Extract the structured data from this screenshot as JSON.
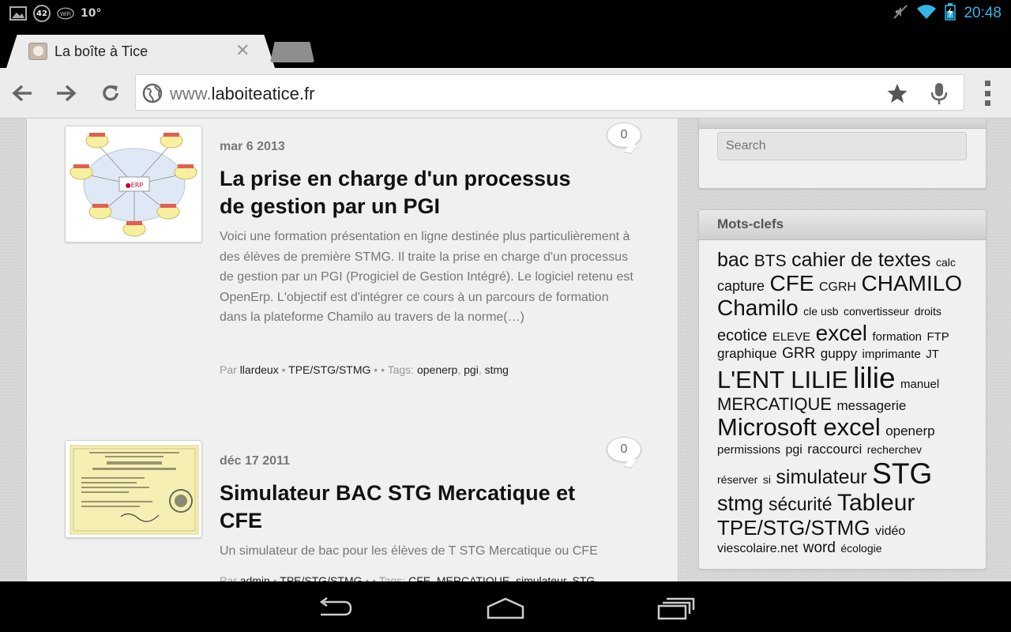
{
  "status_bar": {
    "battery_level": "42",
    "wifi_label": "WiFi",
    "temperature": "10°",
    "time": "20:48"
  },
  "browser": {
    "tab_title": "La boîte à Tice",
    "url_prefix": "www.",
    "url_domain": "laboiteatice.fr"
  },
  "posts": [
    {
      "date": "mar 6 2013",
      "title": "La prise en charge d'un processus de gestion par un PGI",
      "excerpt": "Voici une formation présentation en ligne destinée plus particulièrement à des élèves de première STMG. Il traite la prise en charge d'un processus de gestion par un PGI (Progiciel de Gestion Intégré). Le logiciel retenu est OpenErp. L'objectif est d'intégrer ce cours à un parcours de formation dans la plateforme Chamilo au travers de la norme(…)",
      "comments": "0",
      "meta_by": "Par",
      "author": "llardeux",
      "category": "TPE/STG/STMG",
      "tags_label": "• • Tags:",
      "tags": [
        "openerp",
        "pgi",
        "stmg"
      ]
    },
    {
      "date": "déc 17 2011",
      "title": "Simulateur BAC STG Mercatique et CFE",
      "excerpt": "Un simulateur de bac pour les élèves de T STG Mercatique ou CFE",
      "comments": "0",
      "meta_by": "Par",
      "author": "admin",
      "category": "TPE/STG/STMG",
      "tags_label": "• • Tags:",
      "tags": [
        "CFE",
        "MERCATIQUE",
        "simulateur",
        "STG"
      ]
    }
  ],
  "sidebar": {
    "search_placeholder": "Search",
    "tags_title": "Mots-clefs",
    "tag_cloud": [
      {
        "t": "bac",
        "s": 25
      },
      {
        "t": "BTS",
        "s": 21
      },
      {
        "t": "cahier de textes",
        "s": 25
      },
      {
        "t": "calc",
        "s": 14
      },
      {
        "t": "capture",
        "s": 18
      },
      {
        "t": "CFE",
        "s": 28
      },
      {
        "t": "CGRH",
        "s": 16
      },
      {
        "t": "CHAMILO",
        "s": 28
      },
      {
        "t": "Chamilo",
        "s": 28
      },
      {
        "t": "cle usb",
        "s": 14
      },
      {
        "t": "convertisseur",
        "s": 14
      },
      {
        "t": "droits",
        "s": 14
      },
      {
        "t": "ecotice",
        "s": 20
      },
      {
        "t": "ELEVE",
        "s": 15
      },
      {
        "t": "excel",
        "s": 28
      },
      {
        "t": "formation",
        "s": 15
      },
      {
        "t": "FTP",
        "s": 15
      },
      {
        "t": "graphique",
        "s": 17
      },
      {
        "t": "GRR",
        "s": 19
      },
      {
        "t": "guppy",
        "s": 17
      },
      {
        "t": "imprimante",
        "s": 15
      },
      {
        "t": "JT",
        "s": 15
      },
      {
        "t": "L'ENT LILIE",
        "s": 31
      },
      {
        "t": "lilie",
        "s": 37
      },
      {
        "t": "manuel",
        "s": 15
      },
      {
        "t": "MERCATIQUE",
        "s": 22
      },
      {
        "t": "messagerie",
        "s": 17
      },
      {
        "t": "Microsoft excel",
        "s": 31
      },
      {
        "t": "openerp",
        "s": 17
      },
      {
        "t": "permissions",
        "s": 15
      },
      {
        "t": "pgi",
        "s": 16
      },
      {
        "t": "raccourci",
        "s": 17
      },
      {
        "t": "recherchev",
        "s": 14
      },
      {
        "t": "réserver",
        "s": 14
      },
      {
        "t": "si",
        "s": 14
      },
      {
        "t": "simulateur",
        "s": 25
      },
      {
        "t": "STG",
        "s": 37
      },
      {
        "t": "stmg",
        "s": 27
      },
      {
        "t": "sécurité",
        "s": 23
      },
      {
        "t": "Tableur",
        "s": 30
      },
      {
        "t": "TPE/STG/STMG",
        "s": 26
      },
      {
        "t": "vidéo",
        "s": 16
      },
      {
        "t": "viescolaire.net",
        "s": 16
      },
      {
        "t": "word",
        "s": 19
      },
      {
        "t": "écologie",
        "s": 14
      }
    ]
  },
  "colors": {
    "clock": "#33b5e5",
    "page_bg": "#d8d8d8"
  }
}
